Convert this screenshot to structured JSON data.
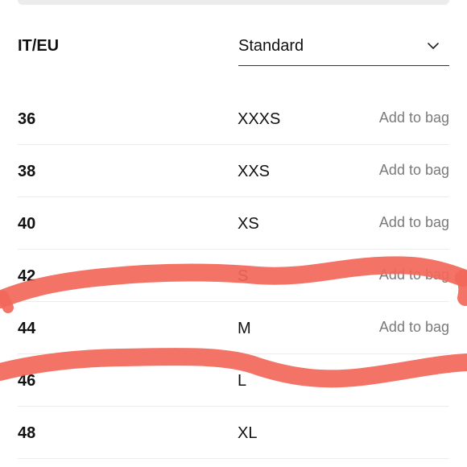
{
  "header": {
    "column_label": "IT/EU",
    "size_system": "Standard"
  },
  "sizes": [
    {
      "eu": "36",
      "std": "XXXS",
      "action": "Add to bag"
    },
    {
      "eu": "38",
      "std": "XXS",
      "action": "Add to bag"
    },
    {
      "eu": "40",
      "std": "XS",
      "action": "Add to bag"
    },
    {
      "eu": "42",
      "std": "S",
      "action": "Add to bag"
    },
    {
      "eu": "44",
      "std": "M",
      "action": "Add to bag"
    },
    {
      "eu": "46",
      "std": "L",
      "action": ""
    },
    {
      "eu": "48",
      "std": "XL",
      "action": ""
    }
  ],
  "colors": {
    "text": "#111111",
    "muted": "#7a7a7a",
    "divider": "#ececec",
    "annotation": "#f2675a"
  },
  "icons": {
    "dropdown": "chevron-down-icon"
  }
}
